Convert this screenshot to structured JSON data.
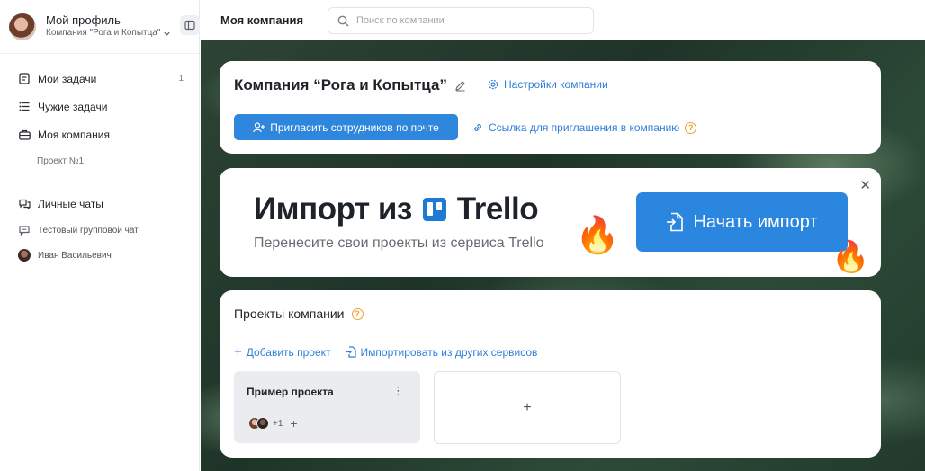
{
  "sidebar": {
    "profile_name": "Мой профиль",
    "company_select": "Компания \"Рога и Копытца\"",
    "items": [
      {
        "label": "Мои задачи",
        "count": "1",
        "icon": "tasks-icon"
      },
      {
        "label": "Чужие задачи",
        "icon": "list-icon"
      },
      {
        "label": "Моя компания",
        "icon": "briefcase-icon"
      }
    ],
    "project_sub": "Проект №1",
    "chats_label": "Личные чаты",
    "chat_items": [
      {
        "label": "Тестовый групповой чат",
        "icon": "chat-icon"
      },
      {
        "label": "Иван Васильевич",
        "icon": "avatar"
      }
    ]
  },
  "topbar": {
    "title": "Моя компания",
    "search_placeholder": "Поиск по компании"
  },
  "company_card": {
    "title": "Компания “Рога и Копытца”",
    "settings_link": "Настройки компании",
    "invite_button": "Пригласить сотрудников по почте",
    "invite_link": "Ссылка для приглашения в компанию"
  },
  "import_banner": {
    "title_prefix": "Импорт из",
    "title_brand": "Trello",
    "subtitle": "Перенесите свои проекты из сервиса Trello",
    "button": "Начать импорт",
    "close": "✕"
  },
  "projects": {
    "title": "Проекты компании",
    "add_project": "Добавить проект",
    "import_other": "Импортировать из других сервисов",
    "items": [
      {
        "name": "Пример проекта",
        "extra_members": "+1"
      }
    ],
    "add_card_symbol": "+"
  },
  "colors": {
    "accent": "#2f86dd",
    "link": "#2f7fd6",
    "help": "#f0a030"
  }
}
